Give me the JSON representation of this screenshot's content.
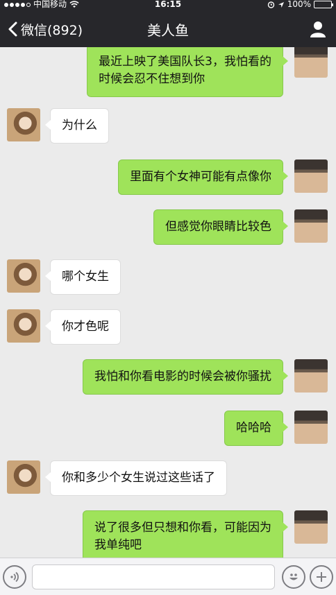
{
  "status": {
    "carrier": "中国移动",
    "time": "16:15",
    "battery": "100%",
    "signal_bars": 4,
    "battery_level": 1.0
  },
  "nav": {
    "back_label": "微信(892)",
    "title": "美人鱼"
  },
  "messages": [
    {
      "from": "me",
      "text": "最近上映了美国队长3，我怕看的\n时候会忍不住想到你"
    },
    {
      "from": "her",
      "text": "为什么"
    },
    {
      "from": "me",
      "text": "里面有个女神可能有点像你"
    },
    {
      "from": "me",
      "text": "但感觉你眼睛比较色"
    },
    {
      "from": "her",
      "text": "哪个女生"
    },
    {
      "from": "her",
      "text": "你才色呢"
    },
    {
      "from": "me",
      "text": "我怕和你看电影的时候会被你骚扰"
    },
    {
      "from": "me",
      "text": "哈哈哈"
    },
    {
      "from": "her",
      "text": "你和多少个女生说过这些话了"
    },
    {
      "from": "me",
      "text": "说了很多但只想和你看，可能因为\n我单纯吧"
    }
  ],
  "input": {
    "value": "",
    "placeholder": ""
  },
  "icons": {
    "voice": "voice-icon",
    "emoji": "emoji-icon",
    "plus": "plus-icon"
  }
}
